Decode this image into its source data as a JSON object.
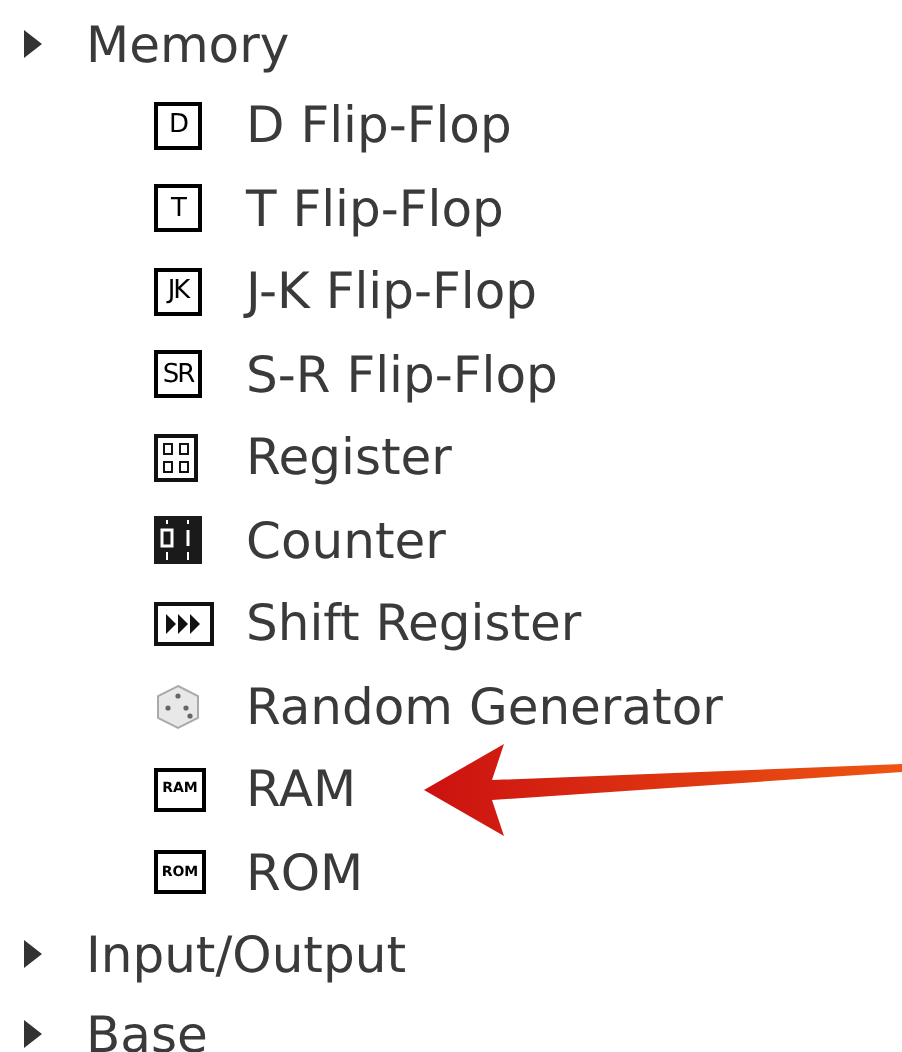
{
  "tree": [
    {
      "label": "Memory",
      "children": [
        {
          "label": "D Flip-Flop",
          "kind": "letter",
          "icon_text": "D"
        },
        {
          "label": "T Flip-Flop",
          "kind": "letter",
          "icon_text": "T"
        },
        {
          "label": "J-K Flip-Flop",
          "kind": "letter",
          "icon_text": "JK"
        },
        {
          "label": "S-R Flip-Flop",
          "kind": "letter",
          "icon_text": "SR"
        },
        {
          "label": "Register",
          "kind": "register"
        },
        {
          "label": "Counter",
          "kind": "counter"
        },
        {
          "label": "Shift Register",
          "kind": "shift"
        },
        {
          "label": "Random Generator",
          "kind": "dice"
        },
        {
          "label": "RAM",
          "kind": "chip",
          "icon_text": "RAM"
        },
        {
          "label": "ROM",
          "kind": "chip",
          "icon_text": "ROM"
        }
      ]
    },
    {
      "label": "Input/Output"
    },
    {
      "label": "Base"
    }
  ]
}
